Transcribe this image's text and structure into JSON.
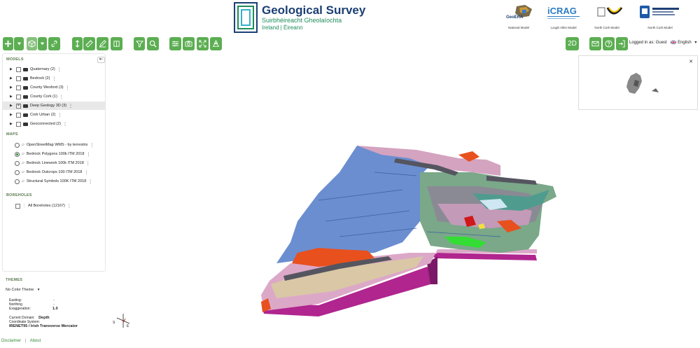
{
  "header": {
    "title": "Geological Survey",
    "subtitle_irish": "Suirbhéireacht Gheolaíochta",
    "subtitle_country": "Ireland | Éireann",
    "partners": [
      {
        "name": "GeoERA",
        "caption": "National Model"
      },
      {
        "name": "iCRAG",
        "caption": "Lough Allen Model"
      },
      {
        "name": "",
        "caption": "North Cork Model"
      },
      {
        "name": "Trinity College Dublin",
        "caption": "North Cork Model"
      }
    ]
  },
  "toolbar": {
    "view_mode": "2D",
    "logged_in_label": "Logged in as: Guest",
    "language": "English"
  },
  "sidebar": {
    "models_heading": "MODELS",
    "models": [
      {
        "label": "Quaternary (2)",
        "checked": false
      },
      {
        "label": "Bedrock (2)",
        "checked": false
      },
      {
        "label": "County Wexford (3)",
        "checked": false
      },
      {
        "label": "County Cork (1)",
        "checked": false
      },
      {
        "label": "Deep Geology 3D (3)",
        "checked": true
      },
      {
        "label": "Cork Urban (2)",
        "checked": false
      },
      {
        "label": "Geoconnected (2)",
        "checked": false
      }
    ],
    "maps_heading": "MAPS",
    "maps": [
      {
        "label": "OpenStreetMap WMS - by terrestris",
        "selected": false
      },
      {
        "label": "Bedrock Polygons 100k ITM 2018",
        "selected": true
      },
      {
        "label": "Bedrock Linework 100k ITM 2018",
        "selected": false
      },
      {
        "label": "Bedrock Outcrops 100 ITM 2018",
        "selected": false
      },
      {
        "label": "Structural Symbols 100K ITM 2018",
        "selected": false
      }
    ],
    "boreholes_heading": "BOREHOLES",
    "boreholes": [
      {
        "label": "All Boreholes (12167)",
        "checked": false
      }
    ]
  },
  "themes": {
    "heading": "THEMES",
    "selected": "No Color Theme",
    "easting_label": "Easting:",
    "easting_value": "-",
    "northing_label": "Northing",
    "northing_value": "-",
    "exaggeration_label": "Exaggeration:",
    "exaggeration_value": "1.0",
    "domain_label": "Current Domain:",
    "domain_value": "Depth",
    "coord_system_label": "Coordinate System:",
    "coord_system_value": "IRENET95 / Irish Transverse Mercator"
  },
  "compass": {
    "s": "S",
    "e": "E"
  },
  "footer": {
    "disclaimer": "Disclaimer",
    "separator": "|",
    "about": "About"
  },
  "colors": {
    "accent_green": "#5cae52",
    "geology_blue": "#6b8ed0",
    "geology_orange": "#e8501e",
    "geology_pink": "#dca8c8",
    "geology_magenta": "#b0258e"
  }
}
